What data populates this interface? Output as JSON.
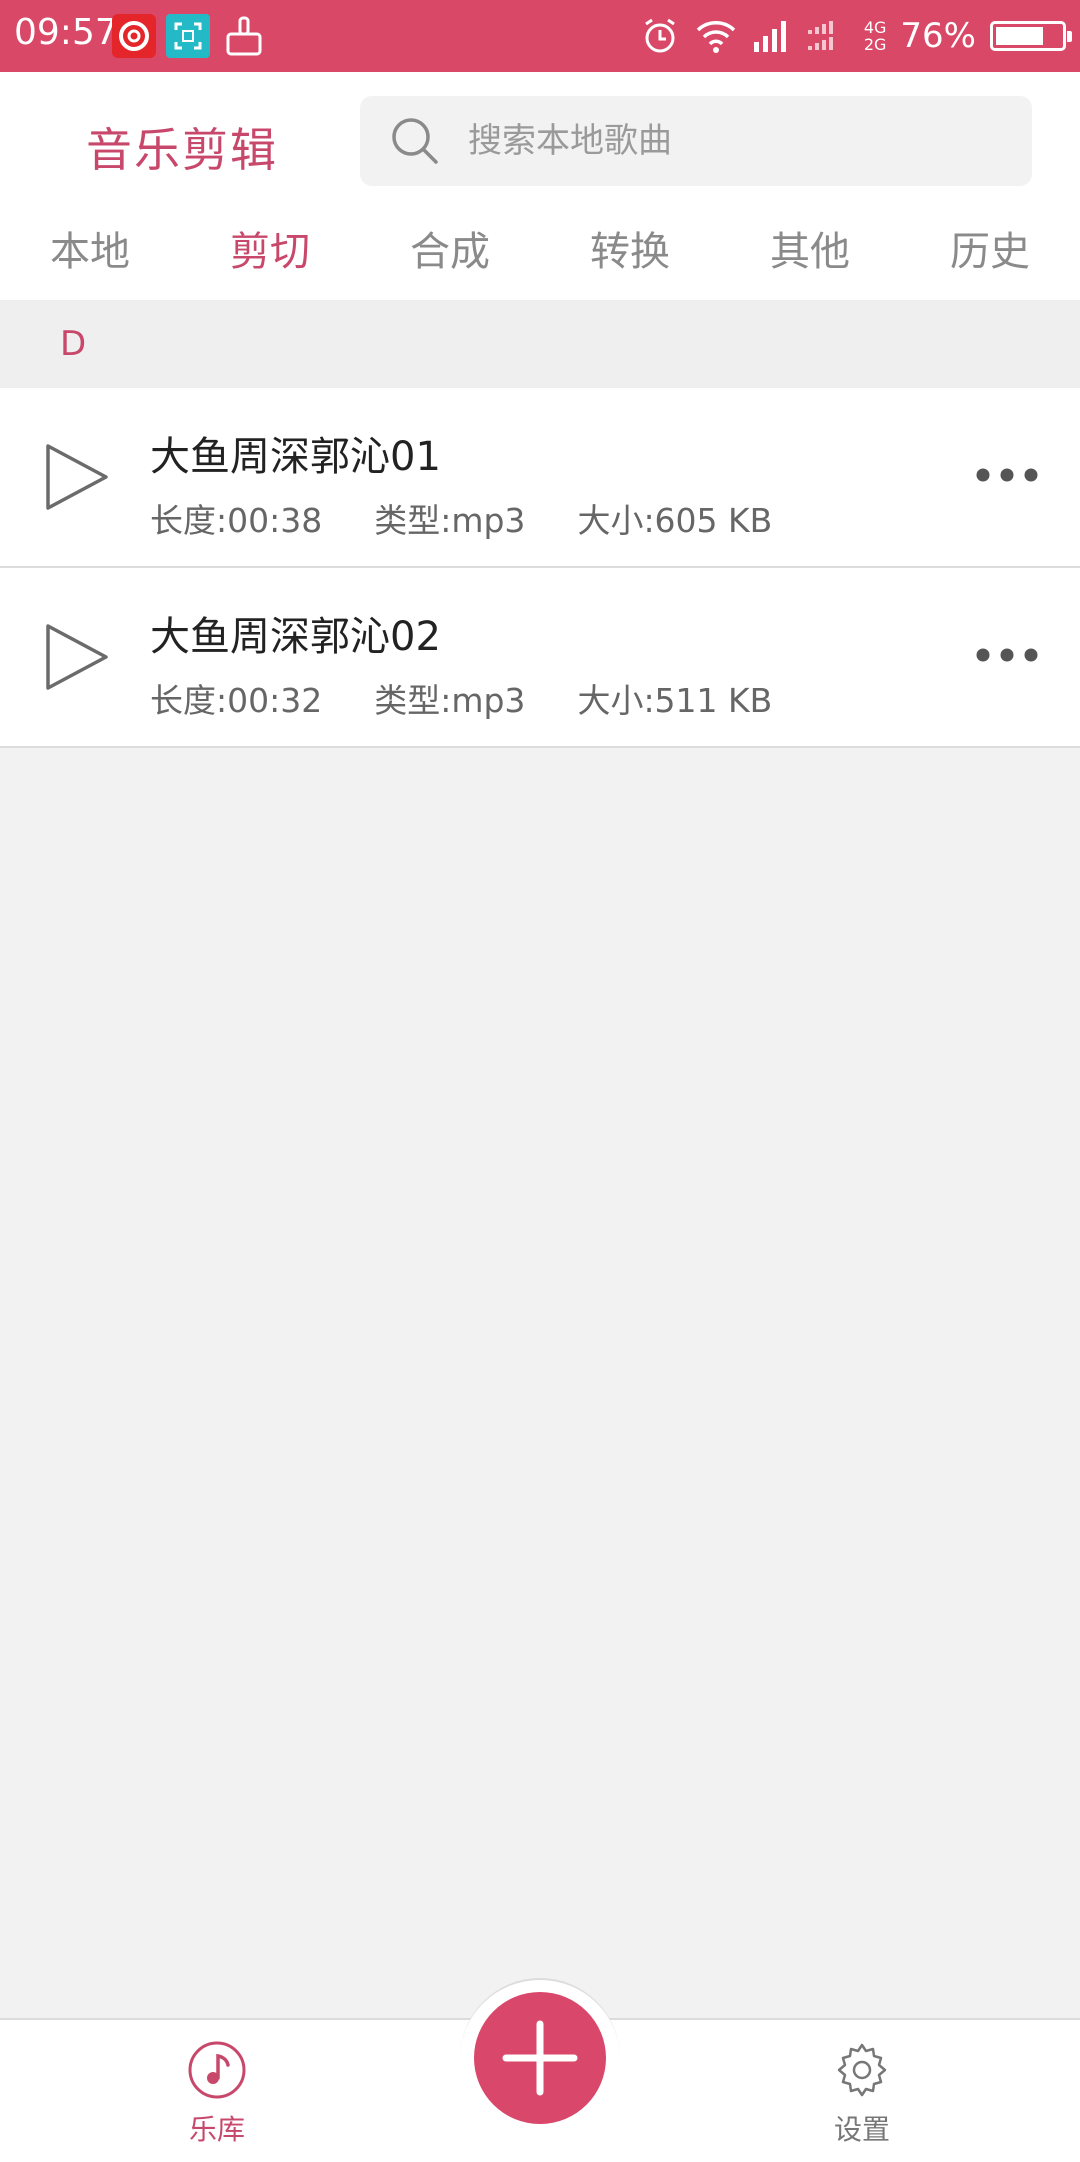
{
  "status_bar": {
    "time": "09:57",
    "network_top": "4G",
    "network_bottom": "2G",
    "battery_percent": "76%",
    "battery_level": 0.76
  },
  "header": {
    "app_title": "音乐剪辑",
    "search_placeholder": "搜索本地歌曲"
  },
  "tabs": [
    {
      "label": "本地",
      "active": false
    },
    {
      "label": "剪切",
      "active": true
    },
    {
      "label": "合成",
      "active": false
    },
    {
      "label": "转换",
      "active": false
    },
    {
      "label": "其他",
      "active": false
    },
    {
      "label": "历史",
      "active": false
    }
  ],
  "section": {
    "letter": "D"
  },
  "songs": [
    {
      "title": "大鱼周深郭沁01",
      "length": "长度:00:38",
      "type": "类型:mp3",
      "size": "大小:605 KB"
    },
    {
      "title": "大鱼周深郭沁02",
      "length": "长度:00:32",
      "type": "类型:mp3",
      "size": "大小:511 KB"
    }
  ],
  "bottom_nav": {
    "library_label": "乐库",
    "settings_label": "设置"
  },
  "colors": {
    "accent": "#c8486b",
    "status_bar": "#d94866",
    "fab": "#d9486a"
  }
}
